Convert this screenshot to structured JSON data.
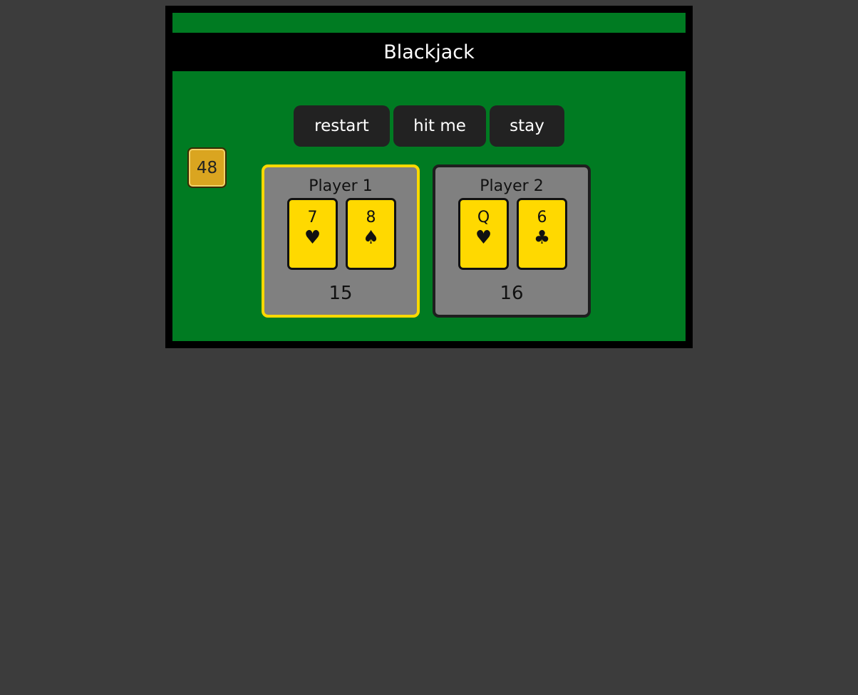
{
  "game": {
    "title": "Blackjack",
    "deck_count": "48"
  },
  "controls": {
    "restart_label": "restart",
    "hit_label": "hit me",
    "stay_label": "stay"
  },
  "players": [
    {
      "name": "Player 1",
      "active": true,
      "cards": [
        {
          "rank": "7",
          "suit": "♥",
          "suit_name": "hearts"
        },
        {
          "rank": "8",
          "suit": "♠",
          "suit_name": "spades"
        }
      ],
      "score": "15"
    },
    {
      "name": "Player 2",
      "active": false,
      "cards": [
        {
          "rank": "Q",
          "suit": "♥",
          "suit_name": "hearts"
        },
        {
          "rank": "6",
          "suit": "♣",
          "suit_name": "clubs"
        }
      ],
      "score": "16"
    }
  ],
  "colors": {
    "felt": "#007b22",
    "card": "#ffd900",
    "active_border": "#ffd900",
    "deck_badge": "#daa520"
  }
}
